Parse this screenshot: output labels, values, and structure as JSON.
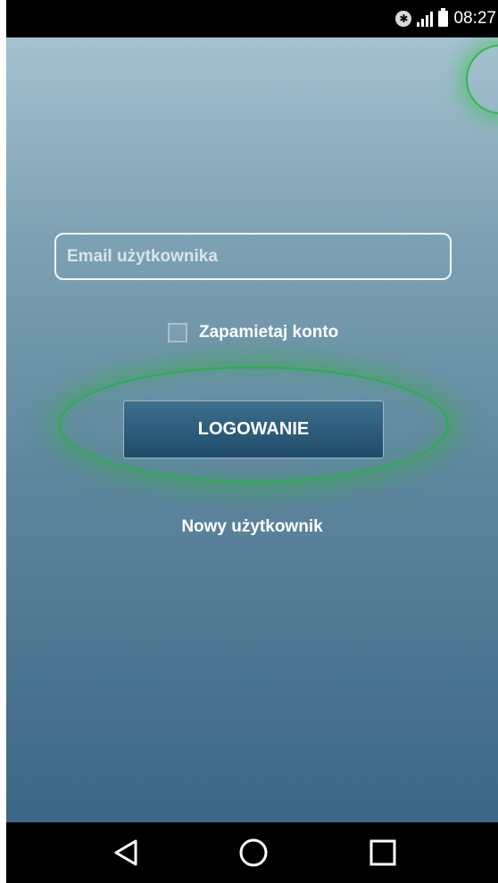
{
  "status_bar": {
    "time": "08:27",
    "bluetooth_icon": "bluetooth-icon",
    "signal_icon": "signal-icon",
    "battery_icon": "battery-icon"
  },
  "login": {
    "email_placeholder": "Email użytkownika",
    "email_value": "",
    "remember_label": "Zapamietaj konto",
    "remember_checked": false,
    "login_button_label": "LOGOWANIE",
    "new_user_link": "Nowy użytkownik"
  },
  "nav_bar": {
    "back_icon": "back-icon",
    "home_icon": "home-icon",
    "recent_icon": "recent-apps-icon"
  },
  "colors": {
    "highlight_green": "#25b049",
    "button_blue": "#1f4b68"
  }
}
